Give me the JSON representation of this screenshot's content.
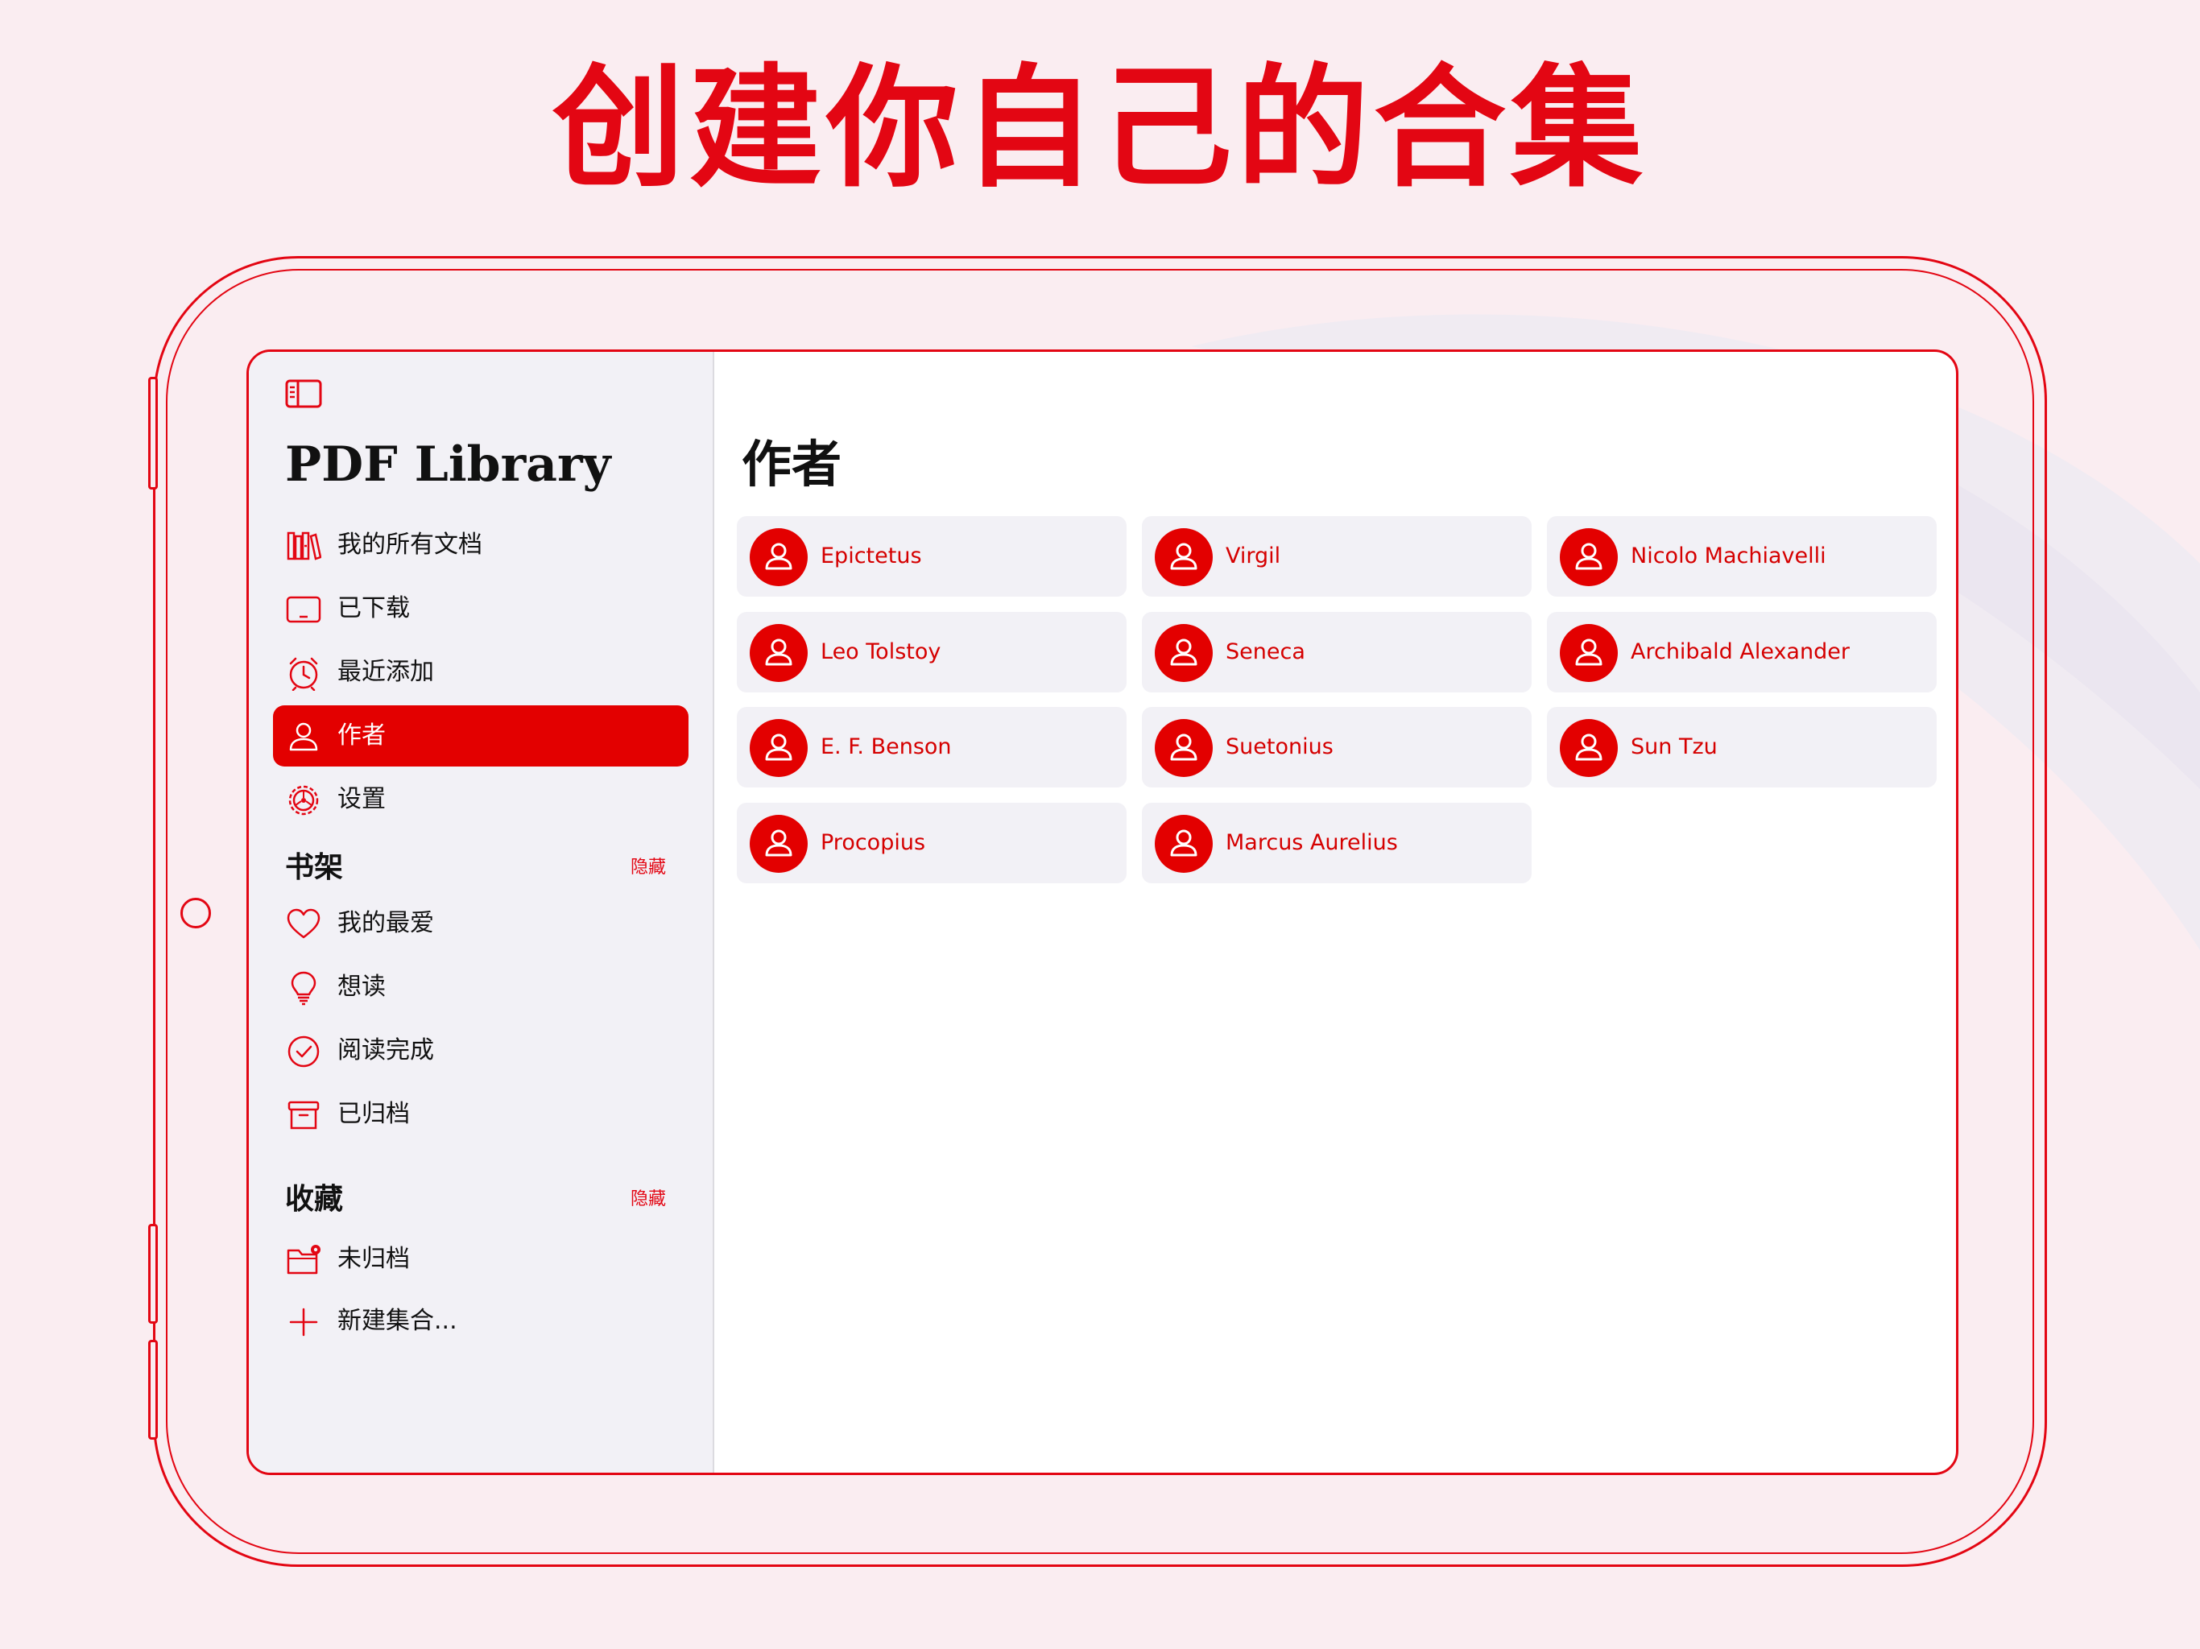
{
  "headline": "创建你自己的合集",
  "app": {
    "title": "PDF Library",
    "sidebar_toggle_icon": "sidebar-icon"
  },
  "nav": [
    {
      "label": "我的所有文档",
      "icon": "books-icon",
      "active": false
    },
    {
      "label": "已下载",
      "icon": "ipad-icon",
      "active": false
    },
    {
      "label": "最近添加",
      "icon": "clock-icon",
      "active": false
    },
    {
      "label": "作者",
      "icon": "person-icon",
      "active": true
    },
    {
      "label": "设置",
      "icon": "gear-icon",
      "active": false
    }
  ],
  "shelves": {
    "title": "书架",
    "hide_label": "隐藏",
    "items": [
      {
        "label": "我的最爱",
        "icon": "heart-icon"
      },
      {
        "label": "想读",
        "icon": "lightbulb-icon"
      },
      {
        "label": "阅读完成",
        "icon": "checkmark-circle-icon"
      },
      {
        "label": "已归档",
        "icon": "archive-box-icon"
      }
    ]
  },
  "collections": {
    "title": "收藏",
    "hide_label": "隐藏",
    "items": [
      {
        "label": "未归档",
        "icon": "folder-badge-icon"
      },
      {
        "label": "新建集合...",
        "icon": "plus-icon"
      }
    ]
  },
  "main": {
    "title": "作者",
    "authors": [
      "Epictetus",
      "Virgil",
      "Nicolo Machiavelli",
      "Leo Tolstoy",
      "Seneca",
      "Archibald Alexander",
      "E. F. Benson",
      "Suetonius",
      "Sun Tzu",
      "Procopius",
      "Marcus Aurelius"
    ]
  },
  "colors": {
    "accent": "#e30613",
    "active_bg": "#e30000",
    "background": "#faedf1",
    "sidebar_bg": "#f2f1f6",
    "card_bg": "#f2f1f6"
  }
}
